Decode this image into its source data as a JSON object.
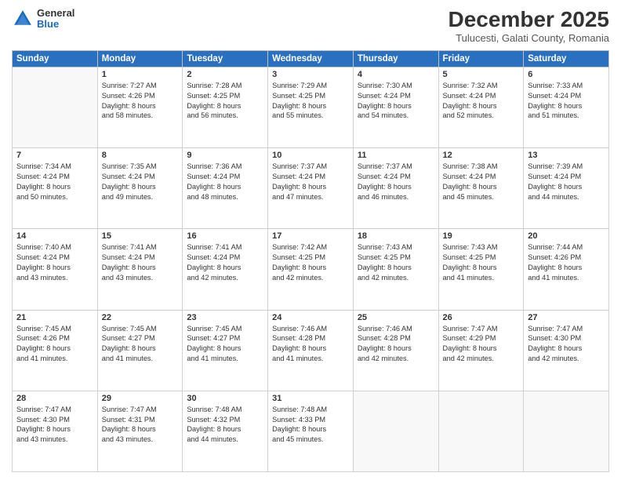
{
  "header": {
    "logo": {
      "general": "General",
      "blue": "Blue"
    },
    "title": "December 2025",
    "subtitle": "Tulucesti, Galati County, Romania"
  },
  "days_of_week": [
    "Sunday",
    "Monday",
    "Tuesday",
    "Wednesday",
    "Thursday",
    "Friday",
    "Saturday"
  ],
  "weeks": [
    [
      {
        "day": null,
        "content": []
      },
      {
        "day": "1",
        "content": [
          "Sunrise: 7:27 AM",
          "Sunset: 4:26 PM",
          "Daylight: 8 hours",
          "and 58 minutes."
        ]
      },
      {
        "day": "2",
        "content": [
          "Sunrise: 7:28 AM",
          "Sunset: 4:25 PM",
          "Daylight: 8 hours",
          "and 56 minutes."
        ]
      },
      {
        "day": "3",
        "content": [
          "Sunrise: 7:29 AM",
          "Sunset: 4:25 PM",
          "Daylight: 8 hours",
          "and 55 minutes."
        ]
      },
      {
        "day": "4",
        "content": [
          "Sunrise: 7:30 AM",
          "Sunset: 4:24 PM",
          "Daylight: 8 hours",
          "and 54 minutes."
        ]
      },
      {
        "day": "5",
        "content": [
          "Sunrise: 7:32 AM",
          "Sunset: 4:24 PM",
          "Daylight: 8 hours",
          "and 52 minutes."
        ]
      },
      {
        "day": "6",
        "content": [
          "Sunrise: 7:33 AM",
          "Sunset: 4:24 PM",
          "Daylight: 8 hours",
          "and 51 minutes."
        ]
      }
    ],
    [
      {
        "day": "7",
        "content": [
          "Sunrise: 7:34 AM",
          "Sunset: 4:24 PM",
          "Daylight: 8 hours",
          "and 50 minutes."
        ]
      },
      {
        "day": "8",
        "content": [
          "Sunrise: 7:35 AM",
          "Sunset: 4:24 PM",
          "Daylight: 8 hours",
          "and 49 minutes."
        ]
      },
      {
        "day": "9",
        "content": [
          "Sunrise: 7:36 AM",
          "Sunset: 4:24 PM",
          "Daylight: 8 hours",
          "and 48 minutes."
        ]
      },
      {
        "day": "10",
        "content": [
          "Sunrise: 7:37 AM",
          "Sunset: 4:24 PM",
          "Daylight: 8 hours",
          "and 47 minutes."
        ]
      },
      {
        "day": "11",
        "content": [
          "Sunrise: 7:37 AM",
          "Sunset: 4:24 PM",
          "Daylight: 8 hours",
          "and 46 minutes."
        ]
      },
      {
        "day": "12",
        "content": [
          "Sunrise: 7:38 AM",
          "Sunset: 4:24 PM",
          "Daylight: 8 hours",
          "and 45 minutes."
        ]
      },
      {
        "day": "13",
        "content": [
          "Sunrise: 7:39 AM",
          "Sunset: 4:24 PM",
          "Daylight: 8 hours",
          "and 44 minutes."
        ]
      }
    ],
    [
      {
        "day": "14",
        "content": [
          "Sunrise: 7:40 AM",
          "Sunset: 4:24 PM",
          "Daylight: 8 hours",
          "and 43 minutes."
        ]
      },
      {
        "day": "15",
        "content": [
          "Sunrise: 7:41 AM",
          "Sunset: 4:24 PM",
          "Daylight: 8 hours",
          "and 43 minutes."
        ]
      },
      {
        "day": "16",
        "content": [
          "Sunrise: 7:41 AM",
          "Sunset: 4:24 PM",
          "Daylight: 8 hours",
          "and 42 minutes."
        ]
      },
      {
        "day": "17",
        "content": [
          "Sunrise: 7:42 AM",
          "Sunset: 4:25 PM",
          "Daylight: 8 hours",
          "and 42 minutes."
        ]
      },
      {
        "day": "18",
        "content": [
          "Sunrise: 7:43 AM",
          "Sunset: 4:25 PM",
          "Daylight: 8 hours",
          "and 42 minutes."
        ]
      },
      {
        "day": "19",
        "content": [
          "Sunrise: 7:43 AM",
          "Sunset: 4:25 PM",
          "Daylight: 8 hours",
          "and 41 minutes."
        ]
      },
      {
        "day": "20",
        "content": [
          "Sunrise: 7:44 AM",
          "Sunset: 4:26 PM",
          "Daylight: 8 hours",
          "and 41 minutes."
        ]
      }
    ],
    [
      {
        "day": "21",
        "content": [
          "Sunrise: 7:45 AM",
          "Sunset: 4:26 PM",
          "Daylight: 8 hours",
          "and 41 minutes."
        ]
      },
      {
        "day": "22",
        "content": [
          "Sunrise: 7:45 AM",
          "Sunset: 4:27 PM",
          "Daylight: 8 hours",
          "and 41 minutes."
        ]
      },
      {
        "day": "23",
        "content": [
          "Sunrise: 7:45 AM",
          "Sunset: 4:27 PM",
          "Daylight: 8 hours",
          "and 41 minutes."
        ]
      },
      {
        "day": "24",
        "content": [
          "Sunrise: 7:46 AM",
          "Sunset: 4:28 PM",
          "Daylight: 8 hours",
          "and 41 minutes."
        ]
      },
      {
        "day": "25",
        "content": [
          "Sunrise: 7:46 AM",
          "Sunset: 4:28 PM",
          "Daylight: 8 hours",
          "and 42 minutes."
        ]
      },
      {
        "day": "26",
        "content": [
          "Sunrise: 7:47 AM",
          "Sunset: 4:29 PM",
          "Daylight: 8 hours",
          "and 42 minutes."
        ]
      },
      {
        "day": "27",
        "content": [
          "Sunrise: 7:47 AM",
          "Sunset: 4:30 PM",
          "Daylight: 8 hours",
          "and 42 minutes."
        ]
      }
    ],
    [
      {
        "day": "28",
        "content": [
          "Sunrise: 7:47 AM",
          "Sunset: 4:30 PM",
          "Daylight: 8 hours",
          "and 43 minutes."
        ]
      },
      {
        "day": "29",
        "content": [
          "Sunrise: 7:47 AM",
          "Sunset: 4:31 PM",
          "Daylight: 8 hours",
          "and 43 minutes."
        ]
      },
      {
        "day": "30",
        "content": [
          "Sunrise: 7:48 AM",
          "Sunset: 4:32 PM",
          "Daylight: 8 hours",
          "and 44 minutes."
        ]
      },
      {
        "day": "31",
        "content": [
          "Sunrise: 7:48 AM",
          "Sunset: 4:33 PM",
          "Daylight: 8 hours",
          "and 45 minutes."
        ]
      },
      {
        "day": null,
        "content": []
      },
      {
        "day": null,
        "content": []
      },
      {
        "day": null,
        "content": []
      }
    ]
  ]
}
